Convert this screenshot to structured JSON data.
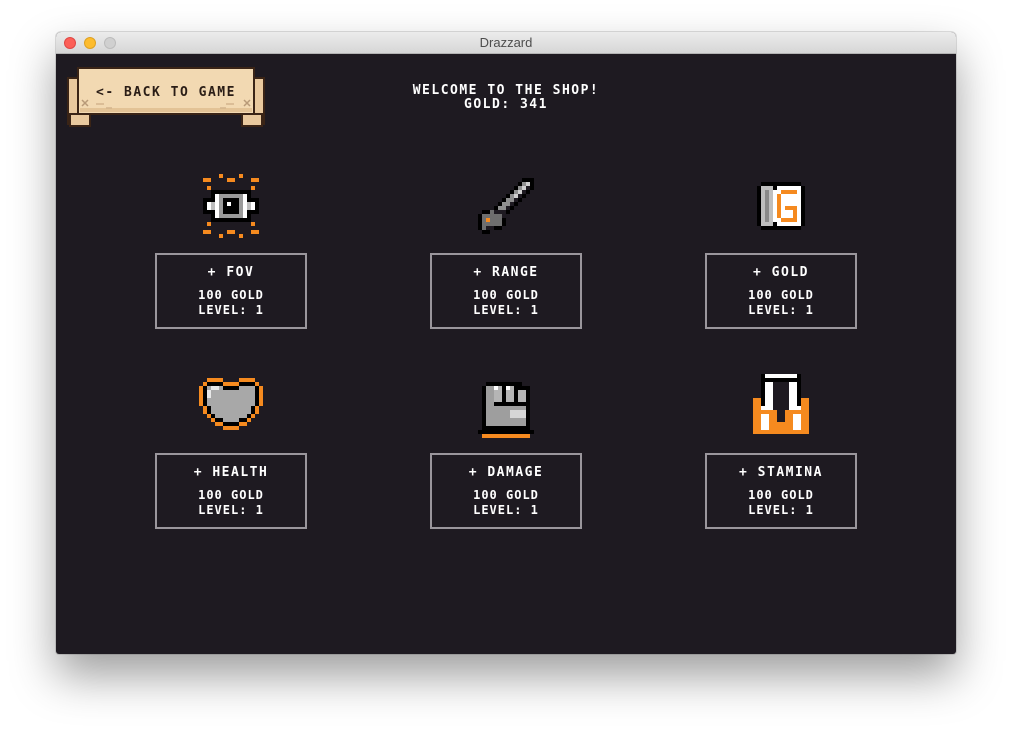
{
  "window": {
    "title": "Drazzard"
  },
  "shop": {
    "back_label": "<- BACK TO GAME",
    "welcome": "WELCOME TO THE SHOP!",
    "gold_label": "GOLD:",
    "gold_value": 341,
    "gold_text": "GOLD: 341"
  },
  "items": [
    {
      "name": "+ FOV",
      "cost": "100 GOLD",
      "level": "LEVEL: 1",
      "icon": "eye-icon"
    },
    {
      "name": "+ RANGE",
      "cost": "100 GOLD",
      "level": "LEVEL: 1",
      "icon": "sword-icon"
    },
    {
      "name": "+ GOLD",
      "cost": "100 GOLD",
      "level": "LEVEL: 1",
      "icon": "gold-coin-icon"
    },
    {
      "name": "+ HEALTH",
      "cost": "100 GOLD",
      "level": "LEVEL: 1",
      "icon": "heart-icon"
    },
    {
      "name": "+ DAMAGE",
      "cost": "100 GOLD",
      "level": "LEVEL: 1",
      "icon": "gauntlet-icon"
    },
    {
      "name": "+ STAMINA",
      "cost": "100 GOLD",
      "level": "LEVEL: 1",
      "icon": "boots-icon"
    }
  ],
  "colors": {
    "background": "#1e1a21",
    "accent_orange": "#f58a1f",
    "card_border": "#9a969c",
    "scroll_parchment": "#f2d9b2",
    "text": "#ffffff"
  }
}
